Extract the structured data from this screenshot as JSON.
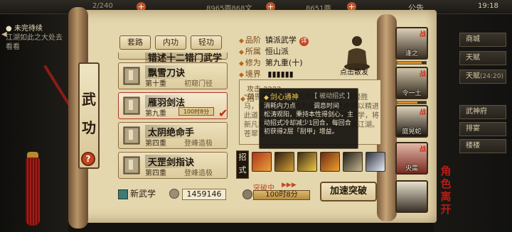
{
  "topbar": {
    "stamina": "2/240",
    "silver": "8965两868文",
    "gold": "8651两",
    "notice": "公告",
    "time": "19:18"
  },
  "quest": {
    "title": "未完待续",
    "desc": "江湖如此之大处去看看"
  },
  "side_buttons": [
    {
      "label": "商城"
    },
    {
      "label": "天赋",
      "sub": "(24:20)"
    },
    {
      "label": "武神府"
    },
    {
      "label": "排宴"
    },
    {
      "label": "楼楼"
    }
  ],
  "panel": {
    "title_chars": [
      "武",
      "功"
    ],
    "help_icon": "question-icon",
    "tabs": [
      "套路",
      "内功",
      "轻功"
    ]
  },
  "list": {
    "partial_top": "错述十二错门武学",
    "items": [
      {
        "name": "飘雪刀诀",
        "level": "第十重",
        "stage": "初窥门径"
      },
      {
        "name": "雁羽剑法",
        "level": "第九重",
        "timer": "100时8分",
        "selected": true
      },
      {
        "name": "太阴绝命手",
        "level": "第四重",
        "stage": "登峰造极"
      },
      {
        "name": "天罡剑指诀",
        "level": "第四重",
        "stage": "登峰造极"
      }
    ]
  },
  "new_art": {
    "label": "新武学",
    "amount": "1459146"
  },
  "detail": {
    "grade_key": "品阶",
    "grade": "镇派武学",
    "grade_badge": "详",
    "faction_key": "所属",
    "faction": "恒山派",
    "cultivation_key": "修为",
    "cultivation": "第九重(十)",
    "realm_key": "境界",
    "monk_label": "点击散发",
    "attack_label": "攻击",
    "attack_value": "2222",
    "move_key": "招",
    "desc": "\"莫畏荆棘路，春风早晚来竹杖芒鞋轻胜马，谁怕。你于修为逐渐积累之中得以精进此道，则明剑心通神之数量，终新武学，将新凡愁情道所发。使此雁羽剑法扬名江湖。苍翠百"
  },
  "tooltip": {
    "name": "剑心通神",
    "tag": "【 被动招式 】",
    "cost": "消耗内力点",
    "cooldown": "调息时间",
    "desc": "松涛观阳，秉持本性得剑心，主动招式冷却减少1回合，每回合初获得2层「刮甲」增益。"
  },
  "moves": {
    "label": "招式",
    "icons": [
      "sword-slash-icon",
      "double-blade-icon",
      "gold-strike-icon",
      "flame-blade-icon",
      "crossed-blades-icon",
      "burst-strike-icon",
      "lightning-icon"
    ]
  },
  "breakthrough": {
    "label": "突破中",
    "timer": "100时8分",
    "button": "加速突破"
  },
  "portraits": [
    {
      "name": "逢之",
      "badge": "战",
      "level_bar": 0.85
    },
    {
      "name": "令一土",
      "badge": "战",
      "level_bar": 0.7
    },
    {
      "name": "庭晃蛇",
      "badge": "战"
    },
    {
      "name": "央需",
      "badge": "战"
    },
    {
      "name": ""
    }
  ],
  "stamp_chars": [
    "角",
    "色",
    "离",
    "开"
  ],
  "colors": {
    "accent_red": "#c7441f",
    "parchment": "#e4d6ad",
    "dark": "#14120f"
  }
}
